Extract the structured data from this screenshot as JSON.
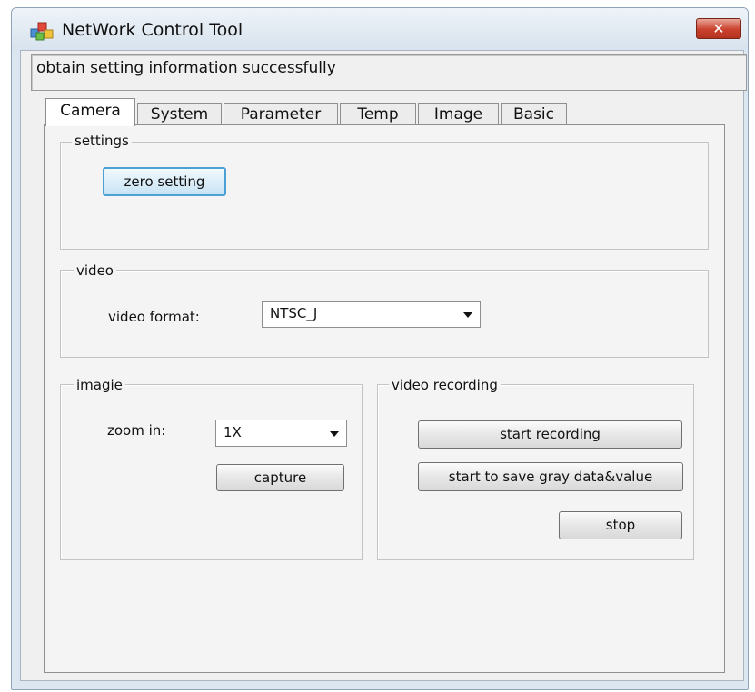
{
  "window": {
    "title": "NetWork Control Tool",
    "close_label": "✕"
  },
  "status": {
    "message": "obtain setting information successfully"
  },
  "tabs": [
    {
      "label": "Camera",
      "active": true
    },
    {
      "label": "System",
      "active": false
    },
    {
      "label": "Parameter",
      "active": false
    },
    {
      "label": "Temp",
      "active": false
    },
    {
      "label": "Image",
      "active": false
    },
    {
      "label": "Basic",
      "active": false
    }
  ],
  "settings": {
    "legend": "settings",
    "zero_button": "zero setting"
  },
  "video": {
    "legend": "video",
    "format_label": "video format:",
    "format_value": "NTSC_J"
  },
  "image_group": {
    "legend": "imagie",
    "zoom_label": "zoom in:",
    "zoom_value": "1X",
    "capture_button": "capture"
  },
  "recording": {
    "legend": "video recording",
    "start_button": "start recording",
    "gray_button": "start to save gray data&value",
    "stop_button": "stop"
  }
}
